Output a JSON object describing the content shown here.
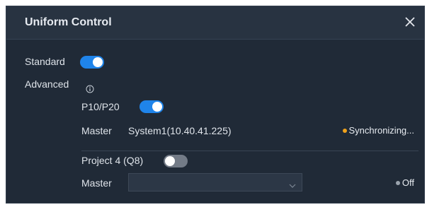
{
  "dialog": {
    "title": "Uniform Control",
    "close_icon": "close-icon"
  },
  "standard": {
    "label": "Standard",
    "enabled": true
  },
  "advanced": {
    "label": "Advanced",
    "info_icon": "info-icon"
  },
  "p10_p20": {
    "label": "P10/P20",
    "enabled": true,
    "master_label": "Master",
    "master_value": "System1(10.40.41.225)",
    "status_text": "Synchronizing...",
    "status_color": "#f0a21c"
  },
  "project4": {
    "label": "Project 4 (Q8)",
    "enabled": false,
    "master_label": "Master",
    "master_value": "",
    "status_text": "Off",
    "status_color": "#9aa3ad"
  },
  "colors": {
    "accent": "#1f84ea",
    "toggle_off": "#737b87",
    "background": "#202a37"
  }
}
